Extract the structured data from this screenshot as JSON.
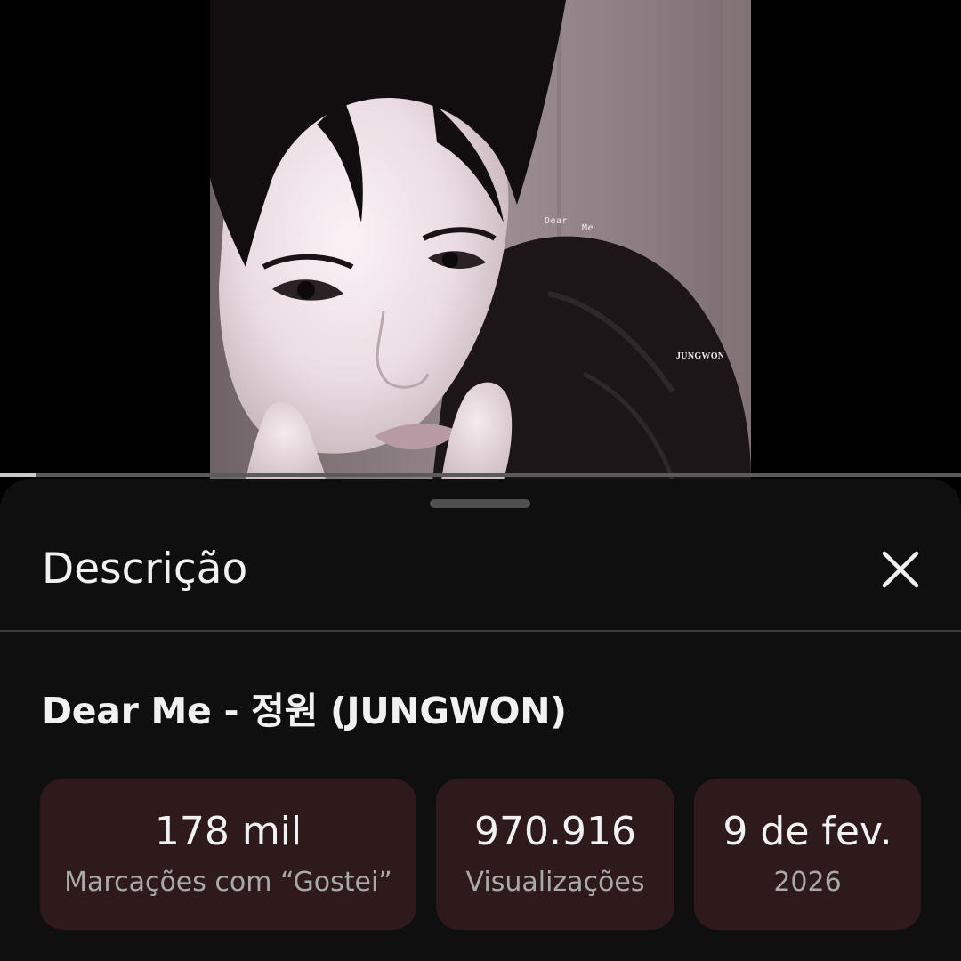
{
  "video": {
    "thumbnail_text": {
      "dear": "Dear",
      "me": "Me",
      "artist": "JUNGWON"
    },
    "progress_fraction": 0.037
  },
  "sheet": {
    "title": "Descrição",
    "close_icon": "close-icon",
    "video_title": "Dear Me - 정원 (JUNGWON)",
    "stats": {
      "likes": {
        "value": "178 mil",
        "label": "Marcações com “Gostei”"
      },
      "views": {
        "value": "970.916",
        "label": "Visualizações"
      },
      "date": {
        "value": "9 de fev.",
        "label": "2026"
      }
    }
  },
  "colors": {
    "background": "#000000",
    "sheet_background": "#0f0f0f",
    "card_background": "#2e1a1a",
    "text_primary": "#f1f1f1",
    "text_secondary": "#a9a9a9"
  }
}
